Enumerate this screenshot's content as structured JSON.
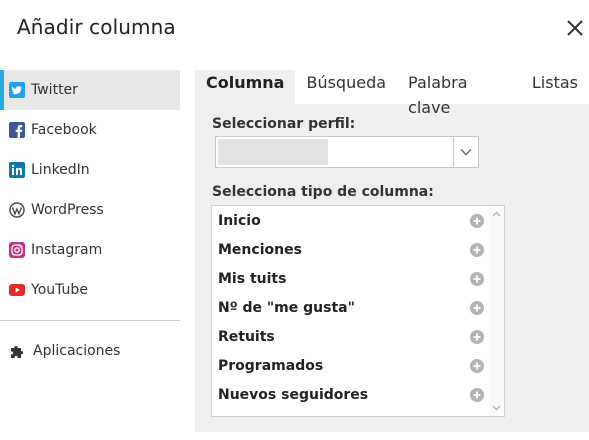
{
  "dialog": {
    "title": "Añadir columna",
    "close_icon": "close-icon"
  },
  "sidebar": {
    "items": [
      {
        "label": "Twitter",
        "icon": "twitter-icon",
        "color": "#1da1f2",
        "active": true
      },
      {
        "label": "Facebook",
        "icon": "facebook-icon",
        "color": "#3b5998",
        "active": false
      },
      {
        "label": "LinkedIn",
        "icon": "linkedin-icon",
        "color": "#0e76a8",
        "active": false
      },
      {
        "label": "WordPress",
        "icon": "wordpress-icon",
        "color": "#464646",
        "active": false
      },
      {
        "label": "Instagram",
        "icon": "instagram-icon",
        "color": "#c13584",
        "active": false
      },
      {
        "label": "YouTube",
        "icon": "youtube-icon",
        "color": "#e52d27",
        "active": false
      }
    ],
    "apps": {
      "label": "Aplicaciones",
      "icon": "puzzle-icon"
    },
    "accent_color": "#2aa9e0"
  },
  "tabs": [
    {
      "label": "Columna",
      "active": true
    },
    {
      "label": "Búsqueda",
      "active": false
    },
    {
      "label": "Palabra clave",
      "active": false
    },
    {
      "label": "Listas",
      "active": false
    }
  ],
  "profile": {
    "label": "Seleccionar perfil:",
    "value": ""
  },
  "column_type": {
    "label": "Selecciona tipo de columna:",
    "items": [
      "Inicio",
      "Menciones",
      "Mis tuits",
      "Nº de \"me gusta\"",
      "Retuits",
      "Programados",
      "Nuevos seguidores"
    ]
  }
}
